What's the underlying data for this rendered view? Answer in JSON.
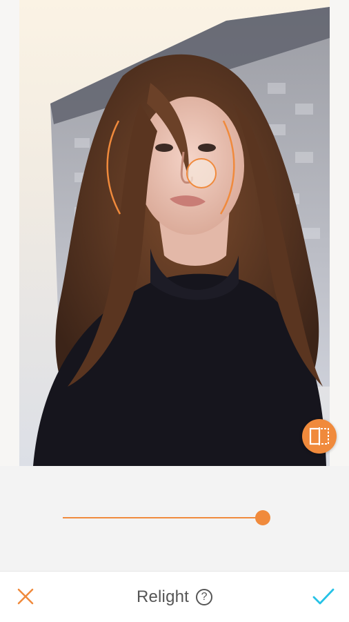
{
  "editor": {
    "title": "Relight",
    "help_label": "?"
  },
  "slider": {
    "value_fraction": 0.93
  },
  "icons": {
    "cancel": "close-icon",
    "confirm": "checkmark-icon",
    "compare": "compare-split-icon",
    "help": "help-circle-icon"
  },
  "colors": {
    "accent": "#f08a3c",
    "confirm": "#25c2e6",
    "controls_background": "#f3f3f3"
  }
}
